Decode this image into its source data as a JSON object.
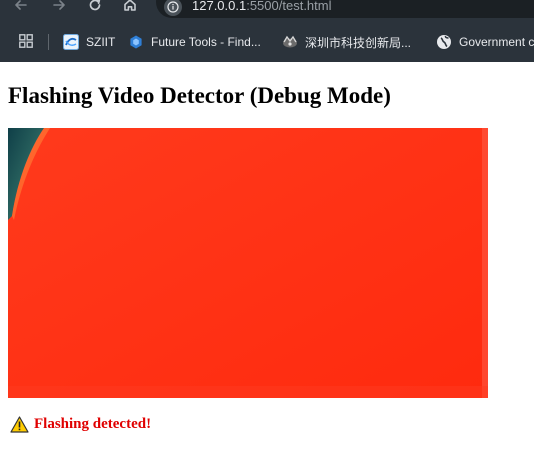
{
  "browser": {
    "url": {
      "host": "127.0.0.1",
      "path": ":5500/test.html"
    },
    "icons": {
      "back": "arrow-left-icon",
      "forward": "arrow-right-icon",
      "reload": "reload-icon",
      "home": "home-icon",
      "site_info": "info-icon",
      "apps": "apps-grid-icon"
    },
    "bookmarks": [
      {
        "label": "SZIIT",
        "icon": "sziit-favicon"
      },
      {
        "label": "Future Tools - Find...",
        "icon": "future-tools-favicon"
      },
      {
        "label": "深圳市科技创新局...",
        "icon": "shenzhen-favicon"
      },
      {
        "label": "Government cl",
        "icon": "globe-icon"
      }
    ]
  },
  "page": {
    "title": "Flashing Video Detector (Debug Mode)",
    "status": {
      "icon": "warning-icon",
      "text": "Flashing detected!",
      "color": "#e00000"
    }
  },
  "colors": {
    "chrome_bg": "#2b333b",
    "video_fill": "#ff2d14"
  }
}
